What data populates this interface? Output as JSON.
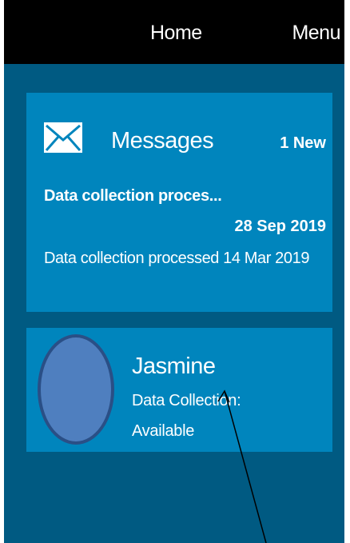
{
  "header": {
    "title": "Home",
    "menu_label": "Menu"
  },
  "messages": {
    "icon": "envelope-icon",
    "title": "Messages",
    "new_count": "1 New",
    "latest_subject": "Data collection proces...",
    "latest_date": "28 Sep 2019",
    "previous": "Data collection processed  14 Mar 2019"
  },
  "profile": {
    "name": "Jasmine",
    "label": "Data Collection:",
    "status": "Available"
  },
  "colors": {
    "header_bg": "#000000",
    "screen_bg": "#005a82",
    "card_bg": "#0085bd",
    "avatar_fill": "#4f7fbf",
    "avatar_border": "#2a4f86",
    "text": "#ffffff"
  }
}
